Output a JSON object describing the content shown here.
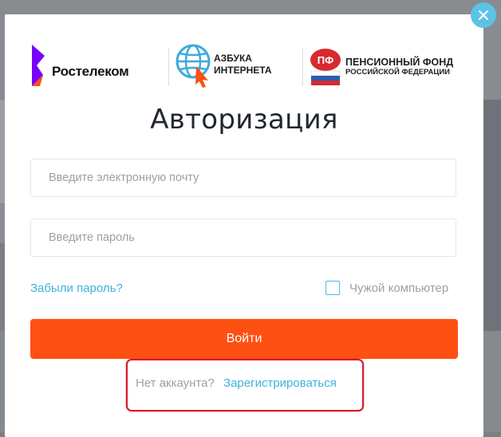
{
  "close": {
    "icon": "close-icon"
  },
  "logos": {
    "rostelecom": {
      "text": "Ростелеком",
      "icon": "rostelecom-logo-icon",
      "color": "#7700ff"
    },
    "azbuka": {
      "line1": "АЗБУКА",
      "line2": "ИНТЕРНЕТА",
      "icon": "globe-cursor-icon"
    },
    "pfr": {
      "line1": "ПЕНСИОННЫЙ ФОНД",
      "line2": "РОССИЙСКОЙ ФЕДЕРАЦИИ",
      "icon": "pfr-emblem-icon"
    }
  },
  "title": "Авторизация",
  "form": {
    "email_placeholder": "Введите электронную почту",
    "password_placeholder": "Введите пароль",
    "email_value": "",
    "password_value": "",
    "forgot_label": "Забыли пароль?",
    "foreign_computer_label": "Чужой компьютер",
    "foreign_computer_checked": false,
    "submit_label": "Войти"
  },
  "register": {
    "question": "Нет аккаунта?",
    "link_label": "Зарегистрироваться"
  },
  "colors": {
    "accent": "#ff5014",
    "link": "#3fb1de",
    "close_bg": "#5cc3e7",
    "highlight_border": "#d91a2a"
  }
}
